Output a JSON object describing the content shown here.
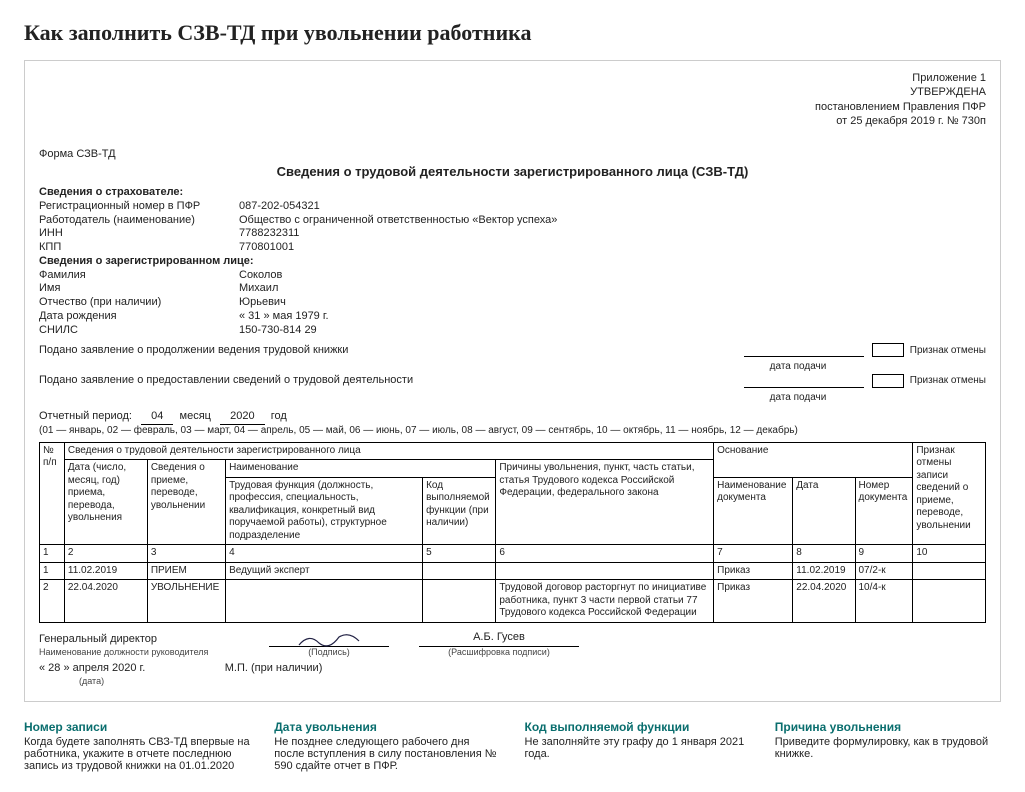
{
  "page_title": "Как заполнить СЗВ-ТД при увольнении работника",
  "approval": {
    "line1": "Приложение 1",
    "line2": "УТВЕРЖДЕНА",
    "line3": "постановлением Правления ПФР",
    "line4": "от 25 декабря 2019 г. № 730п"
  },
  "form_name": "Форма СЗВ-ТД",
  "form_heading": "Сведения о трудовой деятельности зарегистрированного лица (СЗВ-ТД)",
  "insurer": {
    "section": "Сведения о страхователе:",
    "reg_label": "Регистрационный номер в ПФР",
    "reg": "087-202-054321",
    "emp_label": "Работодатель (наименование)",
    "emp": "Общество с ограниченной ответственностью «Вектор успеха»",
    "inn_label": "ИНН",
    "inn": "7788232311",
    "kpp_label": "КПП",
    "kpp": "770801001"
  },
  "person": {
    "section": "Сведения о зарегистрированном лице:",
    "ln_label": "Фамилия",
    "ln": "Соколов",
    "fn_label": "Имя",
    "fn": "Михаил",
    "mn_label": "Отчество (при наличии)",
    "mn": "Юрьевич",
    "dob_label": "Дата рождения",
    "dob": "« 31 » мая  1979 г.",
    "snils_label": "СНИЛС",
    "snils": "150-730-814 29"
  },
  "statements": {
    "s1": "Подано заявление о продолжении ведения трудовой книжки",
    "s2": "Подано заявление о предоставлении сведений о трудовой деятельности",
    "date_cap": "дата подачи",
    "cancel_cap": "Признак отмены"
  },
  "period": {
    "label": "Отчетный период:",
    "month": "04",
    "month_word": "месяц",
    "year": "2020",
    "year_word": "год",
    "note": "(01 — январь, 02 — февраль, 03 — март, 04 — апрель, 05 — май, 06 — июнь, 07 — июль, 08 — август, 09 — сентябрь, 10 — октябрь, 11 — ноябрь, 12 — декабрь)"
  },
  "table": {
    "h_np": "№ п/п",
    "h_group": "Сведения о трудовой деятельности зарегистрированного лица",
    "h_date": "Дата (число, месяц, год) приема, перевода, увольнения",
    "h_event": "Сведения о приеме, переводе, увольнении",
    "h_name": "Наименование",
    "h_func": "Трудовая функция (должность, профессия, специальность, квалификация, конкретный вид поручаемой работы), структурное подразделение",
    "h_code": "Код выполняемой функции (при наличии)",
    "h_reason": "Причины увольнения, пункт, часть статьи, статья Трудового кодекса Российской Федерации, федерального закона",
    "h_basis": "Основание",
    "h_docname": "Наименование документа",
    "h_docdate": "Дата",
    "h_docnum": "Номер документа",
    "h_cancel": "Признак отмены записи сведений о приеме, переводе, увольнении",
    "cols": [
      "1",
      "2",
      "3",
      "4",
      "5",
      "6",
      "7",
      "8",
      "9",
      "10"
    ],
    "rows": [
      {
        "n": "1",
        "date": "11.02.2019",
        "event": "ПРИЕМ",
        "func": "Ведущий эксперт",
        "code": "",
        "reason": "",
        "docname": "Приказ",
        "docdate": "11.02.2019",
        "docnum": "07/2-к",
        "cancel": ""
      },
      {
        "n": "2",
        "date": "22.04.2020",
        "event": "УВОЛЬНЕНИЕ",
        "func": "",
        "code": "",
        "reason": "Трудовой договор расторгнут по инициативе работника, пункт 3 части первой статьи 77 Трудового кодекса Российской Федерации",
        "docname": "Приказ",
        "docdate": "22.04.2020",
        "docnum": "10/4-к",
        "cancel": ""
      }
    ]
  },
  "sig": {
    "role": "Генеральный директор",
    "role_cap": "Наименование должности руководителя",
    "sign_cap": "(Подпись)",
    "name": "А.Б. Гусев",
    "name_cap": "(Расшифровка подписи)",
    "date": "« 28 »   апреля   2020   г.",
    "date_cap": "(дата)",
    "mp": "М.П. (при наличии)"
  },
  "callouts": [
    {
      "title": "Номер записи",
      "text": "Когда будете заполнять СВЗ-ТД впервые на работника, укажите в отчете последнюю запись из трудовой книжки на 01.01.2020"
    },
    {
      "title": "Дата увольнения",
      "text": "Не позднее следующего рабочего дня после вступления в силу постановления № 590 сдайте отчет в ПФР."
    },
    {
      "title": "Код выполняемой функции",
      "text": "Не заполняйте эту графу до 1 января 2021 года."
    },
    {
      "title": "Причина увольнения",
      "text": "Приведите формулировку, как в трудовой книжке."
    }
  ]
}
